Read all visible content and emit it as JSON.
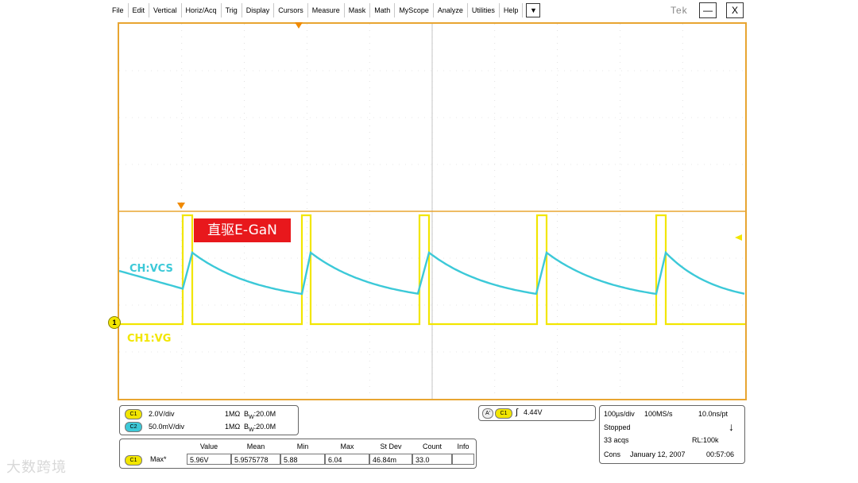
{
  "menu": {
    "items": [
      "File",
      "Edit",
      "Vertical",
      "Horiz/Acq",
      "Trig",
      "Display",
      "Cursors",
      "Measure",
      "Mask",
      "Math",
      "MyScope",
      "Analyze",
      "Utilities",
      "Help"
    ],
    "dropdown_glyph": "▼"
  },
  "window": {
    "logo": "Tek",
    "minimize_glyph": "—",
    "close_glyph": "X"
  },
  "scope": {
    "annotation": "直驱E-GaN",
    "ch_vcs_label": "CH:VCS",
    "ch_vg_label": "CH1:VG",
    "ch1_marker": "1",
    "colors": {
      "frame": "#e8a531",
      "ch1": "#f2e600",
      "ch2": "#3cc9d8",
      "annotation_bg": "#e8181c"
    }
  },
  "channels": [
    {
      "badge": "C1",
      "scale": "2.0V/div",
      "impedance": "1MΩ",
      "bw_prefix": "B",
      "bw_sub": "W",
      "bandwidth": ":20.0M"
    },
    {
      "badge": "C2",
      "scale": "50.0mV/div",
      "impedance": "1MΩ",
      "bw_prefix": "B",
      "bw_sub": "W",
      "bandwidth": ":20.0M"
    }
  ],
  "trigger": {
    "ref": "A'",
    "source": "C1",
    "slope_glyph": "∫",
    "level": "4.44V"
  },
  "measurements": {
    "headers": [
      "Value",
      "Mean",
      "Min",
      "Max",
      "St Dev",
      "Count",
      "Info"
    ],
    "row": {
      "source": "C1",
      "name": "Max*",
      "value": "5.96V",
      "mean": "5.9575778",
      "min": "5.88",
      "max": "6.04",
      "stdev": "46.84m",
      "count": "33.0",
      "info": ""
    }
  },
  "acquisition": {
    "timebase": "100µs/div",
    "sample_rate": "100MS/s",
    "resolution": "10.0ns/pt",
    "state": "Stopped",
    "acqs": "33 acqs",
    "record_length": "RL:100k",
    "mode": "Cons",
    "date": "January 12, 2007",
    "time": "00:57:06",
    "state_glyph": "↓"
  },
  "watermark": "大数跨境"
}
